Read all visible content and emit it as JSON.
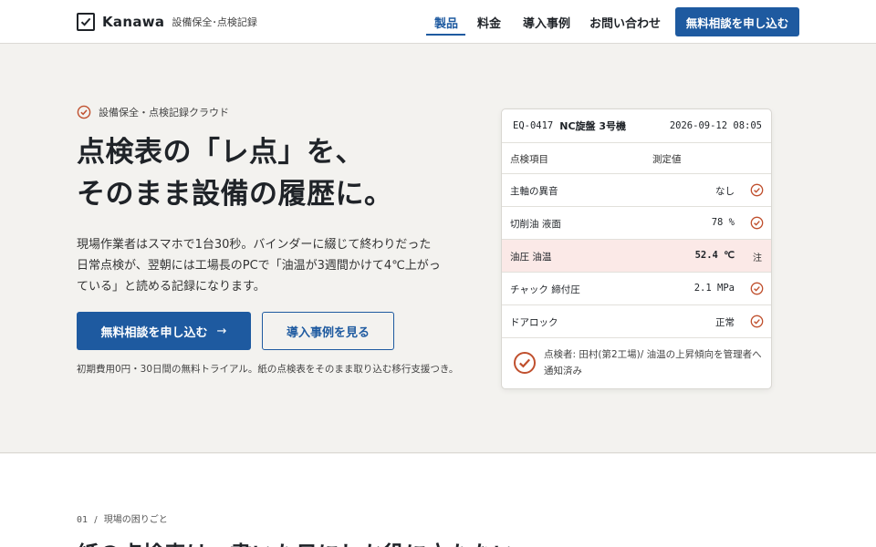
{
  "header": {
    "brand": "Kanawa",
    "brand_sub": "設備保全･点検記録",
    "nav": [
      "製品",
      "料金",
      "導入事例",
      "お問い合わせ"
    ],
    "cta": "無料相談を申し込む"
  },
  "hero": {
    "eyebrow": "設備保全・点検記録クラウド",
    "headline_line1": "点検表の「レ点」を、",
    "headline_line2": "そのまま設備の履歴に。",
    "lead": "現場作業者はスマホで1台30秒。バインダーに綴じて終わりだった日常点検が、翌朝には工場長のPCで「油温が3週間かけて4℃上がっている」と読める記録になります。",
    "primary_button": "無料相談を申し込む",
    "primary_arrow": "→",
    "secondary_button": "導入事例を見る",
    "note": "初期費用0円・30日間の無料トライアル。紙の点検表をそのまま取り込む移行支援つき。"
  },
  "card": {
    "equipment_id": "EQ-0417",
    "equipment_name": "NC旋盤 3号機",
    "timestamp": "2026-09-12 08:05",
    "col_item": "点検項目",
    "col_value": "測定値",
    "rows": [
      {
        "label": "主軸の異音",
        "value": "なし",
        "status": "ok"
      },
      {
        "label": "切削油 液面",
        "value": "78 %",
        "status": "ok"
      },
      {
        "label": "油圧 油温",
        "value": "52.4 ℃",
        "status": "注"
      },
      {
        "label": "チャック 締付圧",
        "value": "2.1 MPa",
        "status": "ok"
      },
      {
        "label": "ドアロック",
        "value": "正常",
        "status": "ok"
      }
    ],
    "footer": "点検者: 田村(第2工場)/ 油温の上昇傾向を管理者へ通知済み"
  },
  "section": {
    "number": "01",
    "separator": "/",
    "label": "現場の困りごと",
    "title": "紙の点検表は、書いた日にしか役に立たない"
  },
  "colors": {
    "accent": "#1e5aa0",
    "check": "#c0502e",
    "alert_bg": "#fbe9e7"
  }
}
